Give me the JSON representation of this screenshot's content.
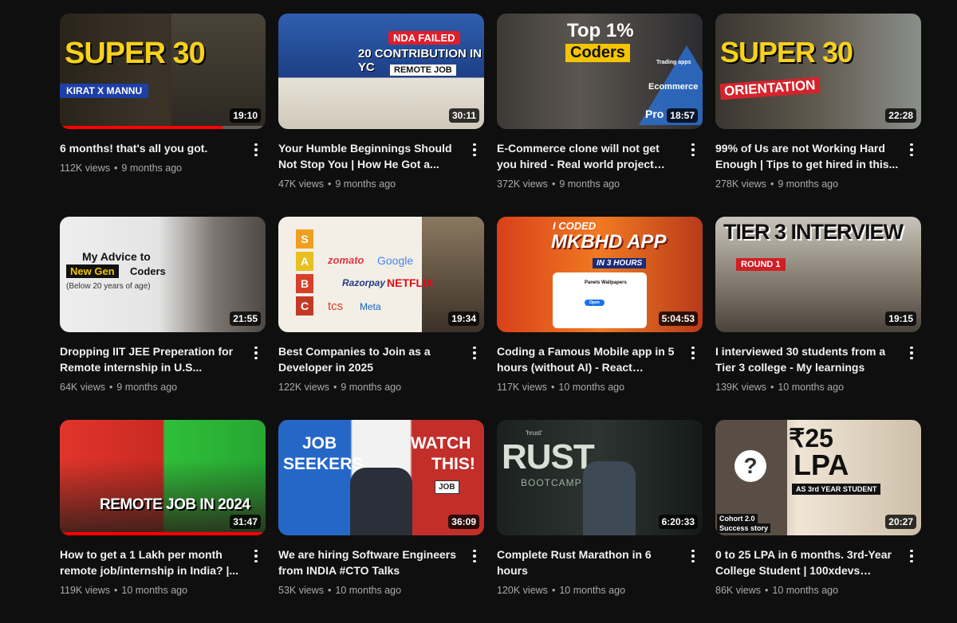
{
  "videos": [
    {
      "title": "6 months! that's all you got.",
      "views": "112K views",
      "age": "9 months ago",
      "duration": "19:10",
      "progress": 0.79,
      "thumb_text": [
        "SUPER 30",
        "KIRAT X MANNU"
      ]
    },
    {
      "title": "Your Humble Beginnings Should Not Stop You | How He Got a...",
      "views": "47K views",
      "age": "9 months ago",
      "duration": "30:11",
      "thumb_text": [
        "NDA FAILED",
        "20 CONTRIBUTION IN YC",
        "REMOTE JOB"
      ]
    },
    {
      "title": "E-Commerce clone will not get you hired - Real world project ideas",
      "views": "372K views",
      "age": "9 months ago",
      "duration": "18:57",
      "thumb_text": [
        "Top 1%",
        "Coders",
        "Trading apps",
        "Ecommerce",
        "Pro"
      ]
    },
    {
      "title": "99% of Us are not Working Hard Enough | Tips to get hired in this...",
      "views": "278K views",
      "age": "9 months ago",
      "duration": "22:28",
      "thumb_text": [
        "SUPER 30",
        "ORIENTATION"
      ]
    },
    {
      "title": "Dropping IIT JEE Preperation for Remote internship in U.S...",
      "views": "64K views",
      "age": "9 months ago",
      "duration": "21:55",
      "thumb_text": [
        "My Advice to",
        "New Gen",
        "Coders",
        "(Below 20 years of age)"
      ]
    },
    {
      "title": "Best Companies to Join as a Developer in 2025",
      "views": "122K views",
      "age": "9 months ago",
      "duration": "19:34",
      "thumb_text": [
        "S",
        "A",
        "B",
        "C",
        "zomato",
        "Google",
        "Razorpay",
        "NETFLIX",
        "tcs",
        "Meta"
      ]
    },
    {
      "title": "Coding a Famous Mobile app in 5 hours (without AI) - React Native,...",
      "views": "117K views",
      "age": "10 months ago",
      "duration": "5:04:53",
      "thumb_text": [
        "I CODED",
        "MKBHD APP",
        "IN 3 HOURS",
        "Panels Wallpapers",
        "Open"
      ]
    },
    {
      "title": "I interviewed 30 students from a Tier 3 college - My learnings",
      "views": "139K views",
      "age": "10 months ago",
      "duration": "19:15",
      "thumb_text": [
        "TIER 3 INTERVIEW",
        "ROUND 1"
      ]
    },
    {
      "title": "How to get a 1 Lakh per month remote job/internship in India? |...",
      "views": "119K views",
      "age": "10 months ago",
      "duration": "31:47",
      "progress": 1.0,
      "thumb_text": [
        "REMOTE JOB IN 2024"
      ]
    },
    {
      "title": "We are hiring Software Engineers from INDIA #CTO Talks",
      "views": "53K views",
      "age": "10 months ago",
      "duration": "36:09",
      "thumb_text": [
        "JOB",
        "SEEKERS",
        "WATCH",
        "THIS!",
        "JOB"
      ]
    },
    {
      "title": "Complete Rust Marathon in 6 hours",
      "views": "120K views",
      "age": "10 months ago",
      "duration": "6:20:33",
      "thumb_text": [
        "'hrust'",
        "RUST",
        "BOOTCAMP"
      ]
    },
    {
      "title": "0 to 25 LPA in 6 months. 3rd-Year College Student | 100xdevs succe...",
      "views": "86K views",
      "age": "10 months ago",
      "duration": "20:27",
      "thumb_text": [
        "₹25",
        "LPA",
        "AS 3rd YEAR STUDENT",
        "Cohort 2.0",
        "Success story"
      ]
    }
  ],
  "separator": "•"
}
